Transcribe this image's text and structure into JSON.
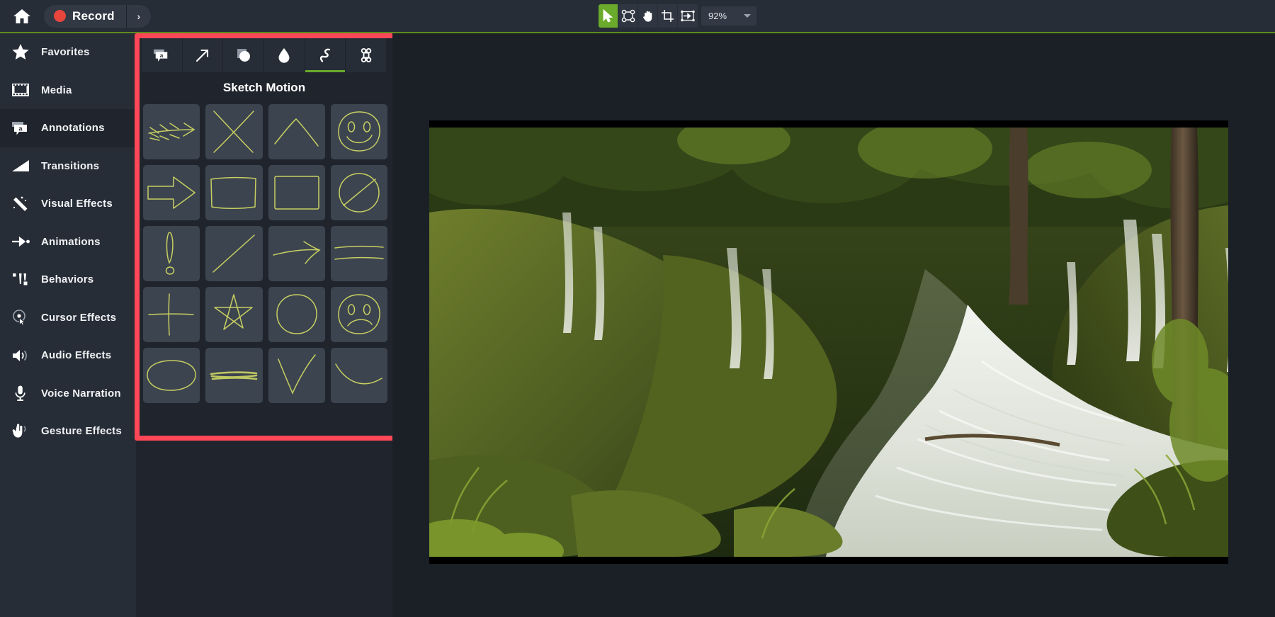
{
  "app": {
    "topbar": {
      "home_icon": "home-icon",
      "record_label": "Record",
      "record_dot_color": "#e8453c",
      "record_more_glyph": "›",
      "zoom_value": "92%",
      "tools": [
        {
          "name": "select-tool",
          "icon": "cursor-arrow-icon",
          "active": true
        },
        {
          "name": "transform-tool",
          "icon": "nodes-icon",
          "active": false
        },
        {
          "name": "pan-tool",
          "icon": "hand-icon",
          "active": false
        },
        {
          "name": "crop-tool",
          "icon": "crop-icon",
          "active": false
        },
        {
          "name": "fit-tool",
          "icon": "fit-arrow-icon",
          "active": false
        }
      ]
    },
    "sidebar": {
      "items": [
        {
          "label": "Favorites",
          "icon": "star-icon",
          "selected": false
        },
        {
          "label": "Media",
          "icon": "filmstrip-icon",
          "selected": false
        },
        {
          "label": "Annotations",
          "icon": "callout-icon",
          "selected": true
        },
        {
          "label": "Transitions",
          "icon": "transition-icon",
          "selected": false
        },
        {
          "label": "Visual Effects",
          "icon": "magic-wand-icon",
          "selected": false
        },
        {
          "label": "Animations",
          "icon": "animation-arrow-icon",
          "selected": false
        },
        {
          "label": "Behaviors",
          "icon": "behaviors-icon",
          "selected": false
        },
        {
          "label": "Cursor Effects",
          "icon": "cursor-effects-icon",
          "selected": false
        },
        {
          "label": "Audio Effects",
          "icon": "speaker-icon",
          "selected": false
        },
        {
          "label": "Voice Narration",
          "icon": "microphone-icon",
          "selected": false
        },
        {
          "label": "Gesture Effects",
          "icon": "gesture-hand-icon",
          "selected": false
        }
      ]
    },
    "panel": {
      "title": "Sketch Motion",
      "highlight_color": "#ff4757",
      "accent_color": "#6aab2b",
      "sketch_stroke_color": "#c7cf62",
      "tabs": [
        {
          "name": "tab-callout",
          "icon": "callout-icon",
          "active": false
        },
        {
          "name": "tab-arrow",
          "icon": "arrow-up-right-icon",
          "active": false
        },
        {
          "name": "tab-shape",
          "icon": "shape-icon",
          "active": false
        },
        {
          "name": "tab-blur",
          "icon": "blur-drop-icon",
          "active": false
        },
        {
          "name": "tab-sketch-motion",
          "icon": "squiggle-icon",
          "active": true
        },
        {
          "name": "tab-keystroke",
          "icon": "command-key-icon",
          "active": false
        }
      ],
      "items": [
        {
          "name": "sketch-feathered-arrow",
          "icon": "feathered-arrow-icon"
        },
        {
          "name": "sketch-cross-x",
          "icon": "x-cross-icon"
        },
        {
          "name": "sketch-caret-up",
          "icon": "caret-up-icon"
        },
        {
          "name": "sketch-smiley-face",
          "icon": "smiley-face-icon"
        },
        {
          "name": "sketch-block-arrow",
          "icon": "block-arrow-icon"
        },
        {
          "name": "sketch-rectangle-open",
          "icon": "rectangle-open-icon"
        },
        {
          "name": "sketch-rectangle",
          "icon": "rectangle-icon"
        },
        {
          "name": "sketch-circle-slash",
          "icon": "circle-slash-icon"
        },
        {
          "name": "sketch-exclamation",
          "icon": "exclamation-icon"
        },
        {
          "name": "sketch-diagonal-line",
          "icon": "diagonal-line-icon"
        },
        {
          "name": "sketch-thin-arrow",
          "icon": "thin-arrow-icon"
        },
        {
          "name": "sketch-double-underline",
          "icon": "double-underline-icon"
        },
        {
          "name": "sketch-plus-cross",
          "icon": "plus-cross-icon"
        },
        {
          "name": "sketch-star",
          "icon": "star-outline-icon"
        },
        {
          "name": "sketch-circle",
          "icon": "circle-icon"
        },
        {
          "name": "sketch-sad-face",
          "icon": "sad-face-icon"
        },
        {
          "name": "sketch-ellipse",
          "icon": "ellipse-icon"
        },
        {
          "name": "sketch-scribble-underline",
          "icon": "scribble-underline-icon"
        },
        {
          "name": "sketch-checkmark",
          "icon": "checkmark-icon"
        },
        {
          "name": "sketch-swoosh",
          "icon": "swoosh-curve-icon"
        }
      ]
    },
    "canvas": {
      "preview_name": "waterfall-forest-video-preview"
    }
  }
}
